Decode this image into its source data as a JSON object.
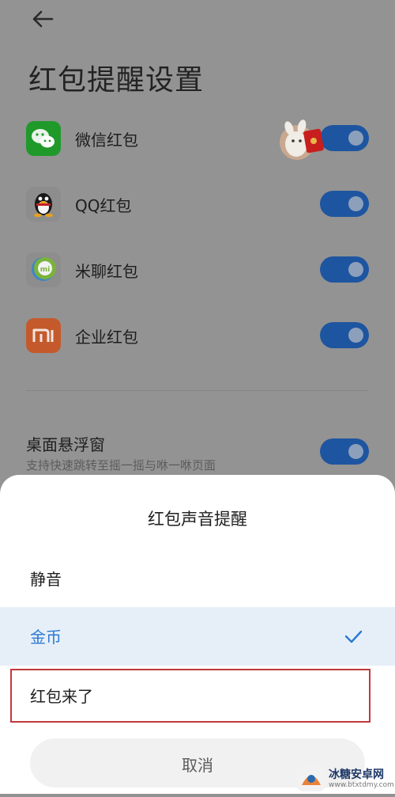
{
  "header": {
    "title": "红包提醒设置",
    "back_icon": "arrow-left-icon"
  },
  "apps": [
    {
      "label": "微信红包",
      "icon": "wechat-icon",
      "color": "#1f9a2a",
      "enabled": true
    },
    {
      "label": "QQ红包",
      "icon": "qq-penguin-icon",
      "color": "#2b2b2b",
      "enabled": true
    },
    {
      "label": "米聊红包",
      "icon": "miliao-icon",
      "color": "#6fa23a",
      "enabled": true
    },
    {
      "label": "企业红包",
      "icon": "mi-icon",
      "color": "#c45a2c",
      "enabled": true
    }
  ],
  "floating_window": {
    "title": "桌面悬浮窗",
    "subtitle": "支持快速跳转至摇一摇与咻一咻页面",
    "enabled": true
  },
  "sound_sheet": {
    "title": "红包声音提醒",
    "options": [
      {
        "label": "静音",
        "selected": false
      },
      {
        "label": "金币",
        "selected": true
      },
      {
        "label": "红包来了",
        "selected": false,
        "highlighted": true
      }
    ],
    "cancel_label": "取消"
  },
  "watermark": {
    "name": "冰糖安卓网",
    "url": "www.btxtdmy.com"
  },
  "colors": {
    "accent": "#2b78d3",
    "toggle": "#1e55a0",
    "highlight_border": "#c0393b"
  }
}
